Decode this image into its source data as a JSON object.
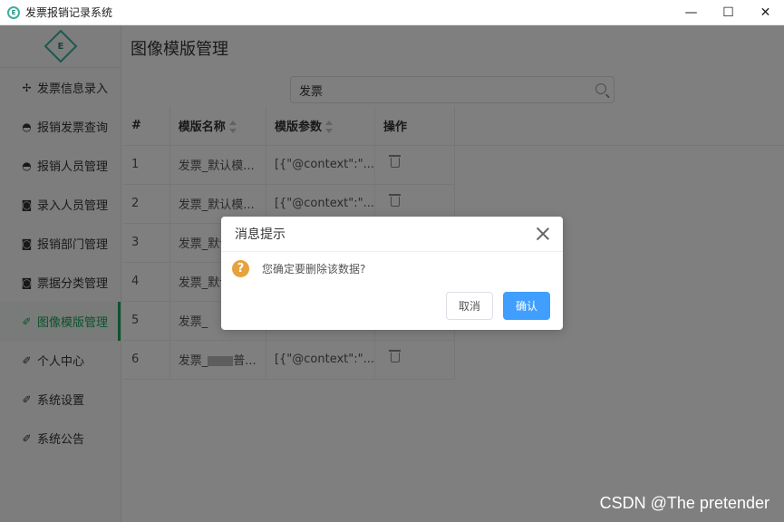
{
  "window": {
    "title": "发票报销记录系统",
    "icon_letter": "E",
    "controls": {
      "minimize": "—",
      "maximize": "☐",
      "close": "✕"
    }
  },
  "sidebar": {
    "logo_text": "E",
    "items": [
      {
        "label": "发票信息录入",
        "icon": "pinwheel-icon",
        "glyph": "✢"
      },
      {
        "label": "报销发票查询",
        "icon": "cake-icon",
        "glyph": "◓"
      },
      {
        "label": "报销人员管理",
        "icon": "cake-icon",
        "glyph": "◓"
      },
      {
        "label": "录入人员管理",
        "icon": "camera-icon",
        "glyph": "◙"
      },
      {
        "label": "报销部门管理",
        "icon": "camera-icon",
        "glyph": "◙"
      },
      {
        "label": "票据分类管理",
        "icon": "camera-icon",
        "glyph": "◙"
      },
      {
        "label": "图像模版管理",
        "icon": "feather-icon",
        "glyph": "✐",
        "active": true
      },
      {
        "label": "个人中心",
        "icon": "feather-icon",
        "glyph": "✐"
      },
      {
        "label": "系统设置",
        "icon": "feather-icon",
        "glyph": "✐"
      },
      {
        "label": "系统公告",
        "icon": "feather-icon",
        "glyph": "✐"
      }
    ]
  },
  "main": {
    "page_title": "图像模版管理",
    "search": {
      "value": "发票"
    },
    "table": {
      "headers": [
        "#",
        "模版名称",
        "模版参数",
        "操作"
      ],
      "rows": [
        {
          "idx": "1",
          "name": "发票_默认模...",
          "param": "[{\"@context\":\"..."
        },
        {
          "idx": "2",
          "name": "发票_默认模...",
          "param": "[{\"@context\":\"..."
        },
        {
          "idx": "3",
          "name": "发票_默认",
          "param": ""
        },
        {
          "idx": "4",
          "name": "发票_默认",
          "param": ""
        },
        {
          "idx": "5",
          "name": "发票_",
          "param": ""
        },
        {
          "idx": "6",
          "name": "发票_",
          "name_suffix": "普...",
          "param": "[{\"@context\":\"..."
        }
      ]
    }
  },
  "dialog": {
    "title": "消息提示",
    "icon_glyph": "?",
    "message": "您确定要删除该数据?",
    "cancel_label": "取消",
    "confirm_label": "确认"
  },
  "watermark": "CSDN @The  pretender",
  "colors": {
    "accent": "#1aa55a",
    "primary": "#409eff",
    "warning": "#e6a23c"
  }
}
